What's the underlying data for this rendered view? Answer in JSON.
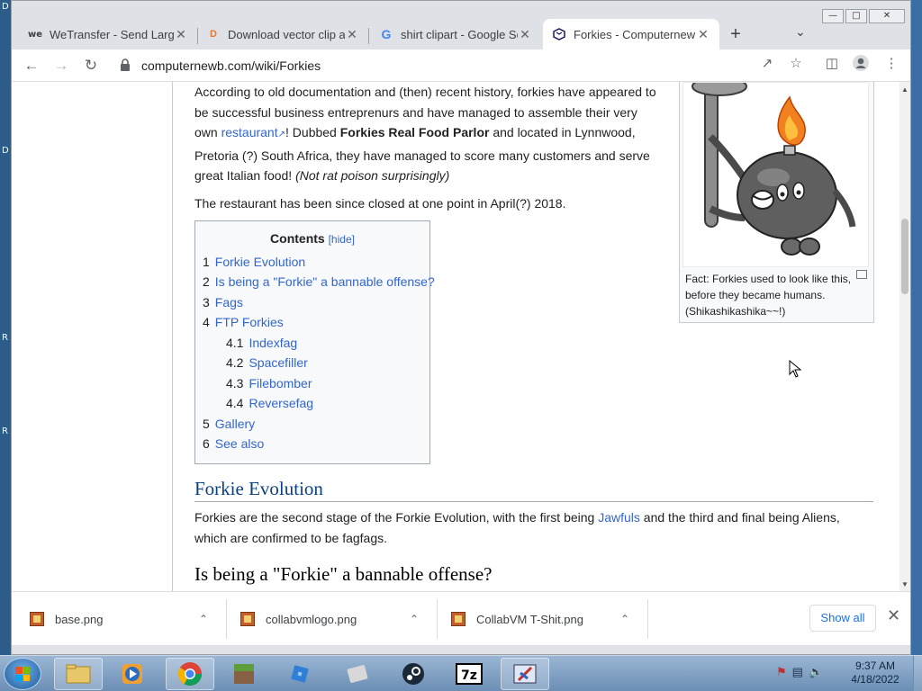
{
  "desktop": {
    "edge_letters": [
      "D",
      "D",
      "R",
      "R"
    ]
  },
  "browser": {
    "tabs": [
      {
        "title": "WeTransfer - Send Large",
        "favicon": "we",
        "active": false
      },
      {
        "title": "Download vector clip ar",
        "favicon": "D",
        "active": false
      },
      {
        "title": "shirt clipart - Google Se",
        "favicon": "G",
        "active": false
      },
      {
        "title": "Forkies - Computernewb",
        "favicon": "wiki",
        "active": true
      }
    ],
    "new_tab_label": "+",
    "url": "computernewb.com/wiki/Forkies"
  },
  "article": {
    "intro": {
      "text_1": "According to old documentation and (then) recent history, forkies have appeared to be successful business entreprenurs and have managed to assemble their very own ",
      "link_restaurant": "restaurant",
      "text_2": "! Dubbed ",
      "bold_name": "Forkies Real Food Parlor",
      "text_3": " and located in Lynnwood, Pretoria (?) South Africa, they have managed to score many customers and serve great Italian food! ",
      "italic_note": "(Not rat poison surprisingly)"
    },
    "closed_note": "The restaurant has been since closed at one point in April(?) 2018.",
    "thumb_caption": "Fact: Forkies used to look like this, before they became humans. (Shikashikashika~~!)",
    "toc": {
      "title": "Contents",
      "hide_label": "[hide]",
      "items": [
        {
          "num": "1",
          "label": "Forkie Evolution",
          "sub": false
        },
        {
          "num": "2",
          "label": "Is being a \"Forkie\" a bannable offense?",
          "sub": false
        },
        {
          "num": "3",
          "label": "Fags",
          "sub": false
        },
        {
          "num": "4",
          "label": "FTP Forkies",
          "sub": false
        },
        {
          "num": "4.1",
          "label": "Indexfag",
          "sub": true
        },
        {
          "num": "4.2",
          "label": "Spacefiller",
          "sub": true
        },
        {
          "num": "4.3",
          "label": "Filebomber",
          "sub": true
        },
        {
          "num": "4.4",
          "label": "Reversefag",
          "sub": true
        },
        {
          "num": "5",
          "label": "Gallery",
          "sub": false
        },
        {
          "num": "6",
          "label": "See also",
          "sub": false
        }
      ]
    },
    "section_evolution": {
      "heading": "Forkie Evolution",
      "text_1": "Forkies are the second stage of the Forkie Evolution, with the first being ",
      "link_jawfuls": "Jawfuls",
      "text_2": " and the third and final being Aliens, which are confirmed to be fagfags."
    },
    "section_bannable": {
      "heading": "Is being a \"Forkie\" a bannable offense?"
    }
  },
  "downloads": {
    "items": [
      {
        "filename": "base.png"
      },
      {
        "filename": "collabvmlogo.png"
      },
      {
        "filename": "CollabVM T-Shit.png"
      }
    ],
    "show_all_label": "Show all"
  },
  "taskbar": {
    "apps": [
      "explorer-icon",
      "media-player-icon",
      "chrome-icon",
      "minecraft-icon",
      "roblox-icon",
      "disc-icon",
      "steam-icon",
      "7zip-icon",
      "paint-icon"
    ],
    "time": "9:37 AM",
    "date": "4/18/2022"
  },
  "colors": {
    "link": "#3366cc",
    "heading": "#0b4080",
    "accent": "#1a73e8"
  }
}
